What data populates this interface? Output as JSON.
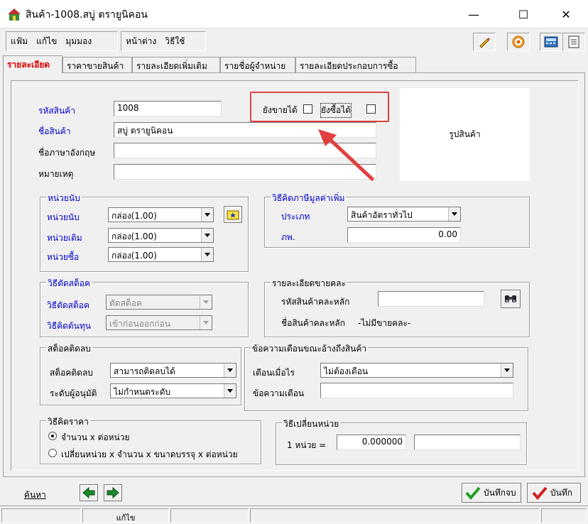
{
  "window": {
    "title": "สินค้า-1008.สบู่ ตรายูนิคอน",
    "minimize_glyph": "—",
    "maximize_glyph": "☐",
    "close_glyph": "✕"
  },
  "menu": {
    "file": "แฟ้ม",
    "edit": "แก้ไข",
    "view": "มุมมอง",
    "window": "หน้าต่าง",
    "help": "วิธีใช้"
  },
  "tabs": [
    {
      "label": "รายละเอียด"
    },
    {
      "label": "ราคาขายสินค้า"
    },
    {
      "label": "รายละเอียดเพิ่มเติม"
    },
    {
      "label": "รายชื่อผู้จำหน่าย"
    },
    {
      "label": "รายละเอียดประกอบการซื้อ"
    }
  ],
  "general": {
    "code_label": "รหัสสินค้า",
    "code_value": "1008",
    "name_label": "ชื่อสินค้า",
    "name_value": "สบู่ ตรายูนิคอน",
    "english_label": "ชื่อภาษาอังกฤษ",
    "english_value": "",
    "note_label": "หมายเหตุ",
    "note_value": "",
    "not_sellable_label": "ยังขายได้",
    "not_buyable_label": "ยังซื้อได้",
    "picture_label": "รูปสินค้า"
  },
  "unit_group": {
    "title": "หน่วยนับ",
    "unit_label": "หน่วยนับ",
    "unit_value": "กล่อง(1.00)",
    "default_label": "หน่วยเติม",
    "default_value": "กล่อง(1.00)",
    "buy_label": "หน่วยซื้อ",
    "buy_value": "กล่อง(1.00)"
  },
  "vat_group": {
    "title": "วิธีคิดภาษีมูลค่าเพิ่ม",
    "type_label": "ประเภท",
    "type_value": "สินค้าอัตราทั่วไป",
    "rate_label": "ภพ.",
    "rate_value": "0.00"
  },
  "stock_group": {
    "title": "วิธีตัดสต็อค",
    "method_label": "วิธีตัดสต็อค",
    "method_value": "ตัดสต็อค",
    "cost_label": "วิธีคิดต้นทุน",
    "cost_value": "เข้าก่อนออกก่อน"
  },
  "wholesale_group": {
    "title": "รายละเอียดขายคละ",
    "code_label": "รหัสสินค้าคละหลัก",
    "code_value": "",
    "name_label": "ชื่อสินค้าคละหลัก",
    "name_value": "-ไม่มีขายคละ-"
  },
  "negative_group": {
    "title": "สต็อคติดลบ",
    "neg_label": "สต็อคติดลบ",
    "neg_value": "สามารถติดลบได้",
    "approve_label": "ระดับผู้อนุมัติ",
    "approve_value": "ไม่กำหนดระดับ"
  },
  "warning_group": {
    "title": "ข้อความเตือนขณะอ้างถึงสินค้า",
    "when_label": "เตือนเมื่อไร",
    "when_value": "ไม่ต้องเตือน",
    "msg_label": "ข้อความเตือน",
    "msg_value": ""
  },
  "price_group": {
    "title": "วิธีคิดราคา",
    "option1": "จำนวน x ต่อหน่วย",
    "option2": "เปลี่ยนหน่วย x จำนวน x ขนาดบรรจุ x ต่อหน่วย",
    "selected": 1
  },
  "convert_group": {
    "title": "วิธีเปลี่ยนหน่วย",
    "unit_label": "1 หน่วย =",
    "factor_value": "0.000000",
    "unit_value": ""
  },
  "footer": {
    "search_label": "ค้นหา",
    "save_close_label": "บันทึกจบ",
    "save_label": "บันทึก"
  },
  "status": {
    "mode": "แก้ไข"
  },
  "colors": {
    "label_blue": "#0000cc",
    "active_tab": "#e00000",
    "highlight": "#e04040"
  }
}
